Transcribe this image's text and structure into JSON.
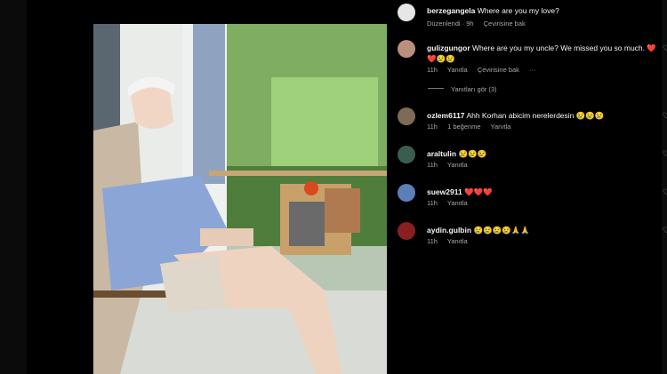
{
  "post": {
    "username": "berzegangela",
    "caption": "Where are you my love?",
    "edited": "Düzenlendi · 9h",
    "translate": "Çevirisine bak"
  },
  "comments": [
    {
      "username": "gulizgungor",
      "text": "Where are you my uncle? We missed you so much. ❤️❤️😢😢",
      "time": "11h",
      "likes": "",
      "reply": "Yanıtla",
      "translate": "Çevirisine bak",
      "more": "···"
    },
    {
      "username": "ozlem6117",
      "text": "Ahh Korhan abicim nerelerdesin 😢😢😢",
      "time": "11h",
      "likes": "1 beğenme",
      "reply": "Yanıtla"
    },
    {
      "username": "araltulin",
      "text": "😢😢😢",
      "time": "11h",
      "reply": "Yanıtla"
    },
    {
      "username": "suew2911",
      "text": "❤️❤️❤️",
      "time": "11h",
      "reply": "Yanıtla"
    },
    {
      "username": "aydin.gulbin",
      "text": "😢😢😢😢🙏🙏",
      "time": "11h",
      "reply": "Yanıtla"
    }
  ],
  "view_replies": "Yanıtları gör (3)",
  "colors": {
    "background": "#000000",
    "text": "#f5f5f5",
    "muted": "#a8a8a8"
  },
  "icons": [
    "heart-icon",
    "avatar",
    "more-icon"
  ]
}
